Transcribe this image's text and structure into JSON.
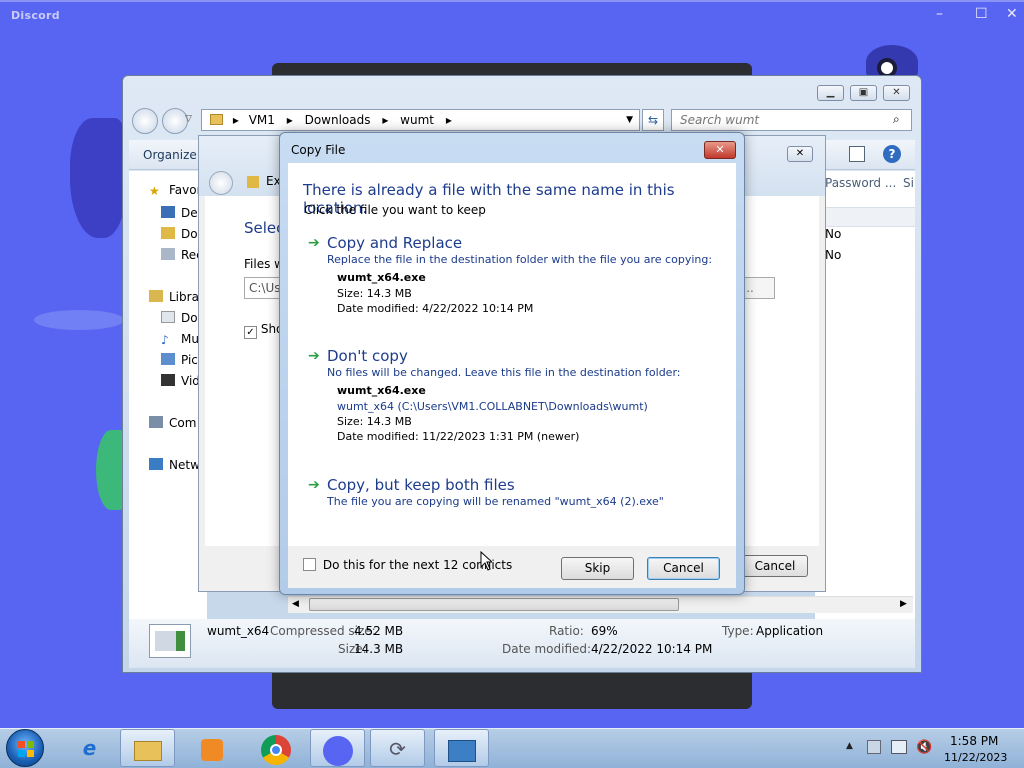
{
  "desktop": {
    "app_title": "Discord",
    "window_controls": [
      "–",
      "☐",
      "✕"
    ]
  },
  "explorer": {
    "breadcrumb": [
      "VM1",
      "Downloads",
      "wumt"
    ],
    "search_placeholder": "Search wumt",
    "organize_label": "Organize",
    "nav_items": [
      "Favor",
      "Des",
      "Dow",
      "Rec",
      "Libra",
      "Doc",
      "Mu",
      "Pic",
      "Vid",
      "Com",
      "Netw"
    ],
    "columns_right": [
      "Password ...",
      "Si"
    ],
    "col_values": [
      "No",
      "No"
    ],
    "status": {
      "name": "wumt_x64",
      "compressed_label": "Compressed size:",
      "compressed_value": "4.52 MB",
      "size_label": "Size:",
      "size_value": "14.3 MB",
      "ratio_label": "Ratio:",
      "ratio_value": "69%",
      "date_label": "Date modified:",
      "date_value": "4/22/2022 10:14 PM",
      "type_label": "Type:",
      "type_value": "Application"
    }
  },
  "wizard": {
    "crumb": "Ext",
    "heading": "Selec",
    "files_label": "Files w",
    "path_value": "C:\\Us",
    "browse_label": "e...",
    "show_label": "Sho",
    "cancel_label": "Cancel"
  },
  "dialog": {
    "title": "Copy File",
    "heading": "There is already a file with the same name in this location.",
    "subheading": "Click the file you want to keep",
    "options": [
      {
        "title": "Copy and Replace",
        "desc": "Replace the file in the destination folder with the file you are copying:",
        "file": "wumt_x64.exe",
        "path": "",
        "size": "Size: 14.3 MB",
        "date": "Date modified: 4/22/2022 10:14 PM"
      },
      {
        "title": "Don't copy",
        "desc": "No files will be changed. Leave this file in the destination folder:",
        "file": "wumt_x64.exe",
        "path": "wumt_x64 (C:\\Users\\VM1.COLLABNET\\Downloads\\wumt)",
        "size": "Size: 14.3 MB",
        "date": "Date modified: 11/22/2023 1:31 PM (newer)"
      },
      {
        "title": "Copy, but keep both files",
        "desc": "The file you are copying will be renamed \"wumt_x64 (2).exe\""
      }
    ],
    "conflicts_label": "Do this for the next 12 conflicts",
    "skip_label": "Skip",
    "cancel_label": "Cancel"
  },
  "taskbar": {
    "time": "1:58 PM",
    "date": "11/22/2023"
  }
}
